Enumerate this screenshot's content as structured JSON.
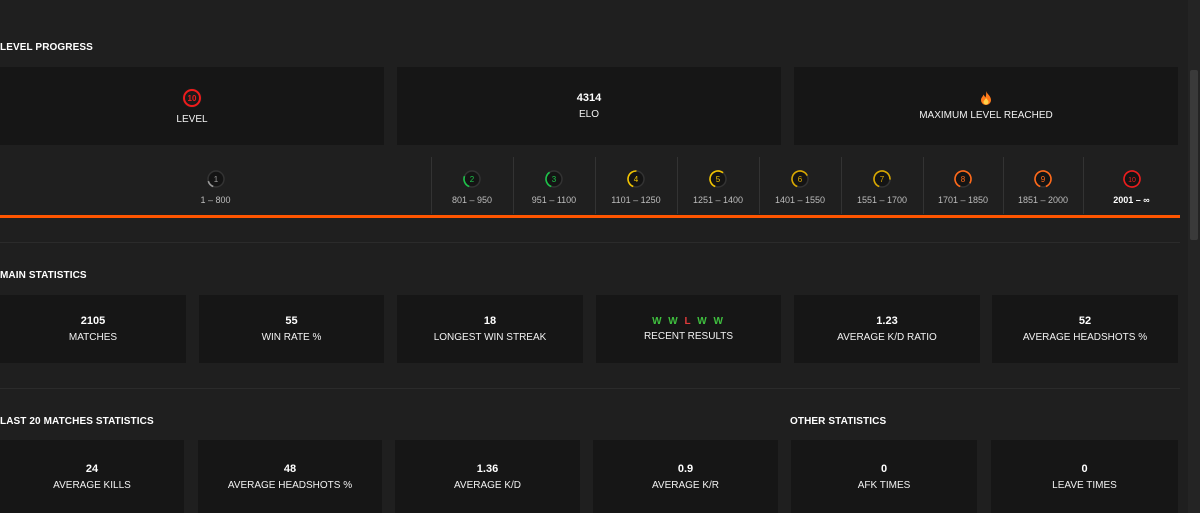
{
  "level_progress": {
    "title": "LEVEL PROGRESS",
    "cards": [
      {
        "value": "10",
        "label": "LEVEL"
      },
      {
        "value": "4314",
        "label": "ELO"
      },
      {
        "icon": "flame-icon",
        "label": "MAXIMUM LEVEL REACHED"
      }
    ],
    "levels": [
      {
        "num": "1",
        "range": "1 – 800",
        "color": "#9a9a9a",
        "fill": 0.15
      },
      {
        "num": "2",
        "range": "801 – 950",
        "color": "#1ec34a",
        "fill": 0.25
      },
      {
        "num": "3",
        "range": "951 – 1100",
        "color": "#1ec34a",
        "fill": 0.35
      },
      {
        "num": "4",
        "range": "1101 – 1250",
        "color": "#f2c400",
        "fill": 0.45
      },
      {
        "num": "5",
        "range": "1251 – 1400",
        "color": "#f2c400",
        "fill": 0.55
      },
      {
        "num": "6",
        "range": "1401 – 1550",
        "color": "#d9a800",
        "fill": 0.62
      },
      {
        "num": "7",
        "range": "1551 – 1700",
        "color": "#d9a800",
        "fill": 0.7
      },
      {
        "num": "8",
        "range": "1701 – 1850",
        "color": "#ff6a1a",
        "fill": 0.78
      },
      {
        "num": "9",
        "range": "1851 – 2000",
        "color": "#ff6a1a",
        "fill": 0.88
      },
      {
        "num": "10",
        "range": "2001 – ∞",
        "color": "#ee1c1c",
        "fill": 1.0
      }
    ],
    "current_level": "10",
    "accent": "#ff5500"
  },
  "main_statistics": {
    "title": "MAIN STATISTICS",
    "cards": [
      {
        "value": "2105",
        "label": "MATCHES"
      },
      {
        "value": "55",
        "label": "WIN RATE %"
      },
      {
        "value": "18",
        "label": "LONGEST WIN STREAK"
      },
      {
        "results": [
          "W",
          "W",
          "L",
          "W",
          "W"
        ],
        "label": "RECENT RESULTS"
      },
      {
        "value": "1.23",
        "label": "AVERAGE K/D RATIO"
      },
      {
        "value": "52",
        "label": "AVERAGE HEADSHOTS %"
      }
    ]
  },
  "last20": {
    "title": "LAST 20 MATCHES STATISTICS",
    "cards": [
      {
        "value": "24",
        "label": "AVERAGE KILLS"
      },
      {
        "value": "48",
        "label": "AVERAGE HEADSHOTS %"
      },
      {
        "value": "1.36",
        "label": "AVERAGE K/D"
      },
      {
        "value": "0.9",
        "label": "AVERAGE K/R"
      }
    ]
  },
  "other": {
    "title": "OTHER STATISTICS",
    "cards": [
      {
        "value": "0",
        "label": "AFK TIMES"
      },
      {
        "value": "0",
        "label": "LEAVE TIMES"
      }
    ]
  },
  "colors": {
    "win": "#3fbf3f",
    "loss": "#e03a3a",
    "background": "#1f1f1f",
    "card": "#161616"
  }
}
